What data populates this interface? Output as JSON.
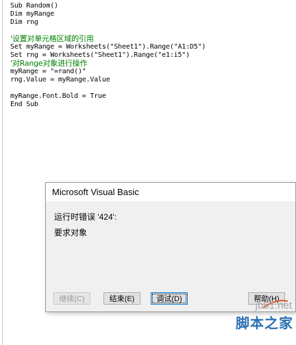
{
  "code": {
    "lines": [
      {
        "text": "Sub Random()",
        "type": "code"
      },
      {
        "text": "Dim myRange",
        "type": "code"
      },
      {
        "text": "Dim rng",
        "type": "code"
      },
      {
        "text": "",
        "type": "blank"
      },
      {
        "text": "'设置对单元格区域的引用",
        "type": "comment"
      },
      {
        "text": "Set myRange = Worksheets(\"Sheet1\").Range(\"A1:D5\")",
        "type": "code"
      },
      {
        "text": "Set rng = Worksheets(\"Sheet1\").Range(\"e1:i5\")",
        "type": "code"
      },
      {
        "text": "'对Range对象进行操作",
        "type": "comment"
      },
      {
        "text": "myRange = \"=rand()\"",
        "type": "code"
      },
      {
        "text": "rng.Value = myRange.Value",
        "type": "code"
      },
      {
        "text": "",
        "type": "blank"
      },
      {
        "text": "myRange.Font.Bold = True",
        "type": "code"
      },
      {
        "text": "End Sub",
        "type": "code"
      }
    ]
  },
  "dialog": {
    "title": "Microsoft Visual Basic",
    "error_line": "运行时错误 '424':",
    "error_message": "要求对象",
    "buttons": {
      "continue": "继续(C)",
      "end": "结束(E)",
      "debug": "调试(D)",
      "help": "帮助(H)"
    }
  },
  "watermark": {
    "url": "jb51.net",
    "text": "脚本之家"
  }
}
